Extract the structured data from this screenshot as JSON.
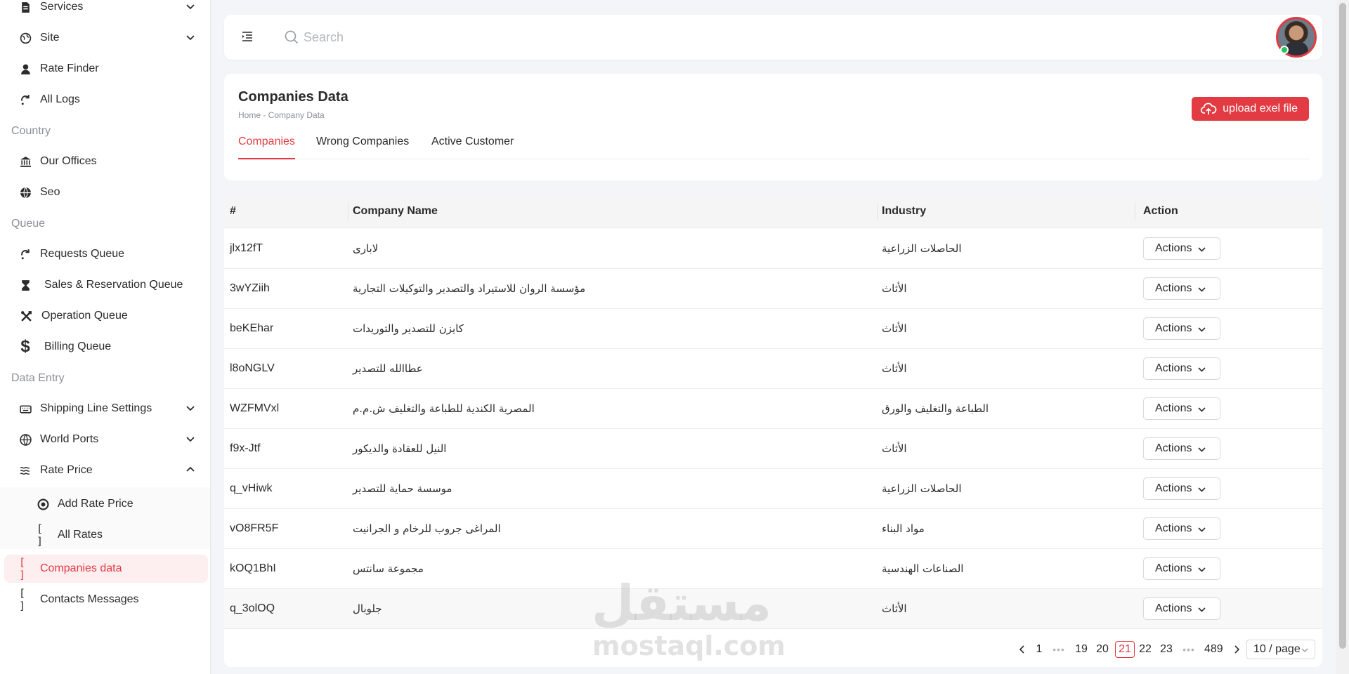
{
  "sidebar": {
    "items": [
      {
        "label": "Services"
      },
      {
        "label": "Site"
      },
      {
        "label": "Rate Finder"
      },
      {
        "label": "All Logs"
      },
      {
        "label": "Our Offices"
      },
      {
        "label": "Seo"
      },
      {
        "label": "Requests Queue"
      },
      {
        "label": "Sales & Reservation Queue"
      },
      {
        "label": "Operation Queue"
      },
      {
        "label": "Billing Queue"
      },
      {
        "label": "Shipping Line Settings"
      },
      {
        "label": "World Ports"
      },
      {
        "label": "Rate Price"
      },
      {
        "label": "Add Rate Price"
      },
      {
        "label": "All Rates"
      },
      {
        "label": "Companies data"
      },
      {
        "label": "Contacts Messages"
      }
    ],
    "sections": [
      "Country",
      "Queue",
      "Data Entry"
    ],
    "bracket_icon": "[ ]"
  },
  "topbar": {
    "search_placeholder": "Search"
  },
  "header": {
    "title": "Companies Data",
    "breadcrumb": "Home - Company Data",
    "upload_label": "upload exel file",
    "tabs": [
      {
        "label": "Companies"
      },
      {
        "label": "Wrong Companies"
      },
      {
        "label": "Active Customer"
      }
    ]
  },
  "table": {
    "columns": [
      "#",
      "Company Name",
      "Industry",
      "Action"
    ],
    "rows": [
      {
        "id": "jlx12fT",
        "name": "لابارى",
        "industry": "الحاصلات الزراعية",
        "action": "Actions"
      },
      {
        "id": "3wYZiih",
        "name": "مؤسسة الروان للاستيراد والتصدير والتوكيلات التجارية",
        "industry": "الأثاث",
        "action": "Actions"
      },
      {
        "id": "beKEhar",
        "name": "كايزن للتصدير والتوريدات",
        "industry": "الأثاث",
        "action": "Actions"
      },
      {
        "id": "l8oNGLV",
        "name": "عطاالله للتصدير",
        "industry": "الأثاث",
        "action": "Actions"
      },
      {
        "id": "WZFMVxl",
        "name": "المصرية الكندية للطباعة والتغليف ش.م.م",
        "industry": "الطباعة والتغليف والورق",
        "action": "Actions"
      },
      {
        "id": "f9x-Jtf",
        "name": "النيل للعقادة والديكور",
        "industry": "الأثاث",
        "action": "Actions"
      },
      {
        "id": "q_vHiwk",
        "name": "موسسة حماية للتصدير",
        "industry": "الحاصلات الزراعية",
        "action": "Actions"
      },
      {
        "id": "vO8FR5F",
        "name": "المراغى جروب للرخام و الجرانيت",
        "industry": "مواد البناء",
        "action": "Actions"
      },
      {
        "id": "kOQ1BhI",
        "name": "مجموعة سانتس",
        "industry": "الصناعات الهندسية",
        "action": "Actions"
      },
      {
        "id": "q_3olOQ",
        "name": "جلوبال",
        "industry": "الأثاث",
        "action": "Actions"
      }
    ]
  },
  "pagination": {
    "pages": [
      "1",
      "•••",
      "19",
      "20",
      "21",
      "22",
      "23",
      "•••",
      "489"
    ],
    "current": "21",
    "page_size": "10 / page"
  },
  "watermark": {
    "arabic": "مستقل",
    "latin": "mostaql.com"
  },
  "colors": {
    "accent": "#e23b43",
    "active_bg": "#fdeef0"
  }
}
